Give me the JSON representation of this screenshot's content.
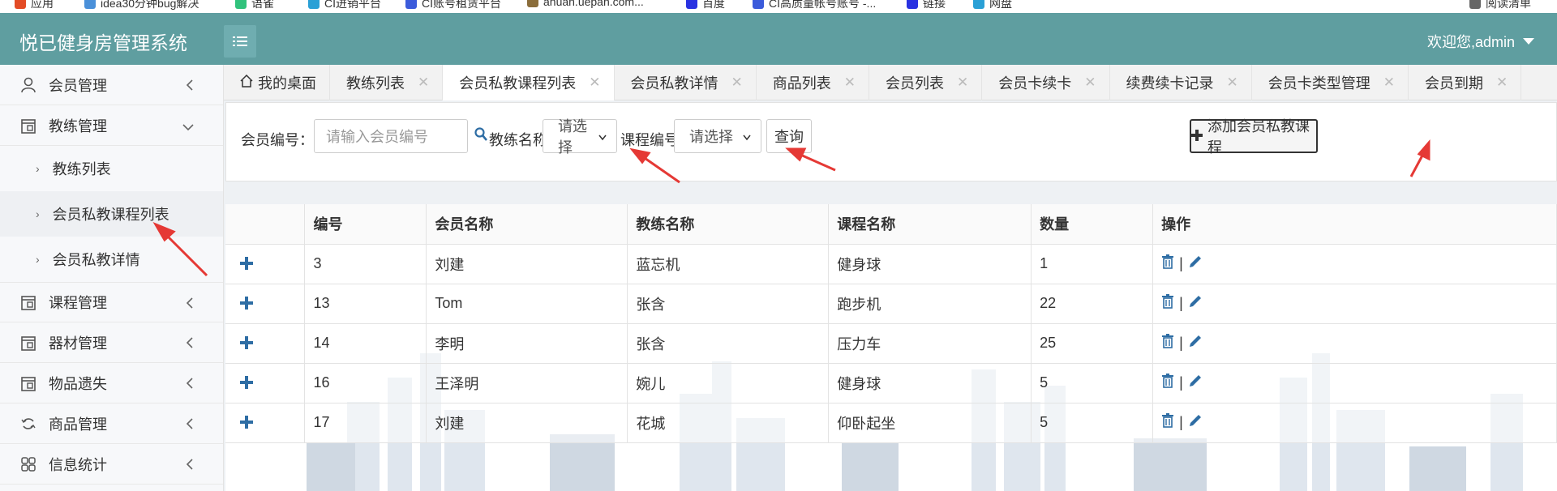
{
  "bookmarks": [
    {
      "label": "应用",
      "color": "#e34c26"
    },
    {
      "label": "idea30分钟bug解决",
      "color": "#4a90d9"
    },
    {
      "label": "语雀",
      "color": "#31c27c"
    },
    {
      "label": "CI进销平台",
      "color": "#2aa0d6"
    },
    {
      "label": "CI账号租赁平台",
      "color": "#3b5bdb"
    },
    {
      "label": "anuan.uepan.com...",
      "color": "#8a6d3b"
    },
    {
      "label": "百度",
      "color": "#2932e1"
    },
    {
      "label": "CI高质量帐号账号 -...",
      "color": "#3b5bdb"
    },
    {
      "label": "链接",
      "color": "#2932e1"
    },
    {
      "label": "网盘",
      "color": "#2aa0d6"
    },
    {
      "label": "阅读清单",
      "color": "#666666"
    }
  ],
  "header": {
    "title": "悦已健身房管理系统",
    "welcome": "欢迎您,admin",
    "bg_color": "#5f9ea0"
  },
  "sidebar": {
    "items": [
      {
        "label": "会员管理",
        "icon": "user-icon"
      },
      {
        "label": "教练管理",
        "icon": "calendar-icon"
      },
      {
        "label": "课程管理",
        "icon": "calendar-icon"
      },
      {
        "label": "器材管理",
        "icon": "calendar-icon"
      },
      {
        "label": "物品遗失",
        "icon": "calendar-icon"
      },
      {
        "label": "商品管理",
        "icon": "refresh-icon"
      },
      {
        "label": "信息统计",
        "icon": "grid-icon"
      }
    ],
    "sub_items": [
      {
        "label": "教练列表"
      },
      {
        "label": "会员私教课程列表"
      },
      {
        "label": "会员私教详情"
      }
    ]
  },
  "tabs": [
    {
      "label": "我的桌面"
    },
    {
      "label": "教练列表"
    },
    {
      "label": "会员私教课程列表"
    },
    {
      "label": "会员私教详情"
    },
    {
      "label": "商品列表"
    },
    {
      "label": "会员列表"
    },
    {
      "label": "会员卡续卡"
    },
    {
      "label": "续费续卡记录"
    },
    {
      "label": "会员卡类型管理"
    },
    {
      "label": "会员到期"
    }
  ],
  "filter": {
    "member_no_label": "会员编号：",
    "member_no_placeholder": "请输入会员编号",
    "coach_label": "教练名称:",
    "coach_value": "请选择",
    "course_label": "课程编号:",
    "course_value": "请选择",
    "query_label": "查询",
    "add_label": "添加会员私教课程"
  },
  "table": {
    "headers": [
      "编号",
      "会员名称",
      "教练名称",
      "课程名称",
      "数量",
      "操作"
    ],
    "rows": [
      [
        "3",
        "刘建",
        "蓝忘机",
        "健身球",
        "1"
      ],
      [
        "13",
        "Tom",
        "张含",
        "跑步机",
        "22"
      ],
      [
        "14",
        "李明",
        "张含",
        "压力车",
        "25"
      ],
      [
        "16",
        "王泽明",
        "婉儿",
        "健身球",
        "5"
      ],
      [
        "17",
        "刘建",
        "花城",
        "仰卧起坐",
        "5"
      ]
    ],
    "op_separator": "|"
  }
}
